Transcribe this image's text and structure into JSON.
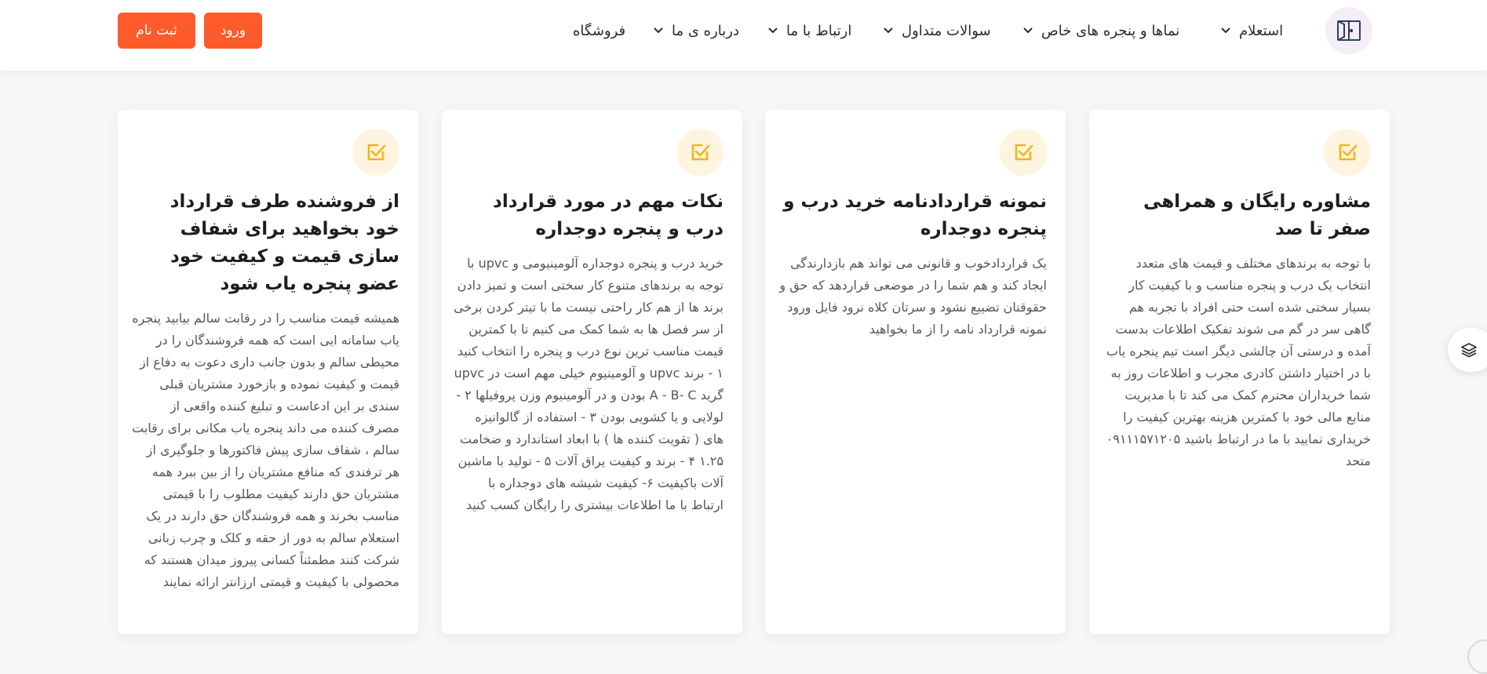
{
  "header": {
    "nav": [
      {
        "label": "استعلام"
      },
      {
        "label": "نماها و پنجره های خاص"
      },
      {
        "label": "سوالات متداول"
      },
      {
        "label": "ارتباط با ما"
      },
      {
        "label": "درباره ی ما"
      },
      {
        "label": "فروشگاه"
      }
    ],
    "login_label": "ورود",
    "register_label": "ثبت نام",
    "accent": "#ff5a29"
  },
  "cards": [
    {
      "title": "مشاوره رایگان و همراهی صفر تا صد",
      "text": "با توجه به برندهای مختلف و قیمت های متعدد انتخاب یک درب و پنجره مناسب و با کیفیت کار بسیار سختی شده است حتی افراد با تجربه هم گاهی سر در گم می شوند تفکیک اطلاعات بدست آمده و درستی آن چالشی دیگر است تیم پنجره یاب با در اختیار داشتن کادری مجرب و اطلاعات روز به شما خریداران محترم کمک می کند تا با مدیریت منابع مالی خود با کمترین هزینه بهترین کیفیت را خریداری نمایید با ما در ارتباط باشید ۰۹۱۱۱۵۷۱۲۰۵ متحد"
    },
    {
      "title": "نمونه قراردادنامه خرید درب و پنجره دوجداره",
      "text": "یک قراردادخوب و قانونی می تواند هم بازدارندگی ایجاد کند و هم شما را در موضعی قراردهد که حق و حقوقتان تضییع نشود و سرتان کلاه نرود فایل ورود نمونه قرارداد نامه را از ما بخواهید"
    },
    {
      "title": "نکات مهم در مورد قرارداد درب و پنجره دوجداره",
      "text": "خرید درب و پنجره دوجداره آلومینیومی و upvc با توجه به برندهای متنوع کار سختی است و تمیز دادن برند ها از هم کار راحتی نیست ما با تیتر کردن برخی از سر فصل ها به شما کمک می کنیم تا با کمترین قیمت مناسب ترین نوع درب و پنجره را انتخاب کنید ۱ - برند upvc و آلومینیوم خیلی مهم است در upvc گرید A - B- C بودن و در آلومینیوم وزن پروفیلها ۲ - لولایی و یا کشویی بودن ۳ - استفاده از گالوانیزه های ( تقویت کننده ها ) با ابعاد استاندارد و ضخامت ۱.۲۵ ۴ - برند و کیفیت یراق آلات ۵ - تولید با ماشین آلات باکیفیت ۶- کیفیت شیشه های دوجداره با ارتباط با ما اطلاعات بیشتری را رایگان کسب کنید"
    },
    {
      "title": "از فروشنده طرف قرارداد خود بخواهید برای شفاف سازی قیمت و کیفیت خود عضو پنجره یاب شود",
      "text": "همیشه قیمت مناسب را در رقابت سالم بیابید پنجره یاب سامانه ایی است که همه فروشندگان را در محیطی سالم و بدون جانب داری دعوت به دفاع از قیمت و کیفیت نموده و بازخورد مشتریان قبلی سندی بر این ادعاست و تبلیغ کننده واقعی از مصرف کننده می داند پنجره یاب مکانی برای رقابت سالم ، شفاف سازی پیش فاکتورها و جلوگیری از هر ترفندی که منافع مشتریان را از بین ببرد همه مشتریان حق دارند کیفیت مطلوب را با قیمتی مناسب بخرند و همه فروشندگان حق دارند در یک استعلام سالم به دور از حقه و کلک و چرب زبانی شرکت کنند مطمئناً کسانی پیروز میدان هستند که محصولی با کیفیت و قیمتی ارزانتر ارائه نمایند"
    }
  ]
}
